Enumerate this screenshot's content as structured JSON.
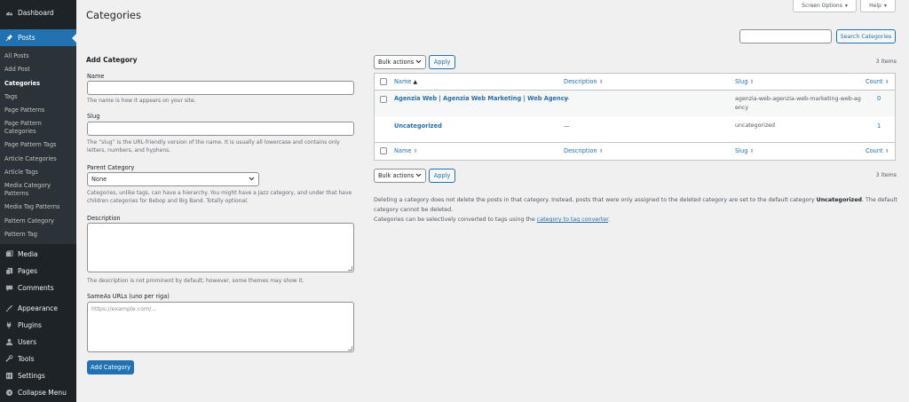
{
  "sidebar": {
    "dashboard": {
      "label": "Dashboard",
      "icon": "dashboard-icon"
    },
    "posts": {
      "label": "Posts",
      "icon": "pin-icon"
    },
    "submenu": [
      {
        "label": "All Posts"
      },
      {
        "label": "Add Post"
      },
      {
        "label": "Categories"
      },
      {
        "label": "Tags"
      },
      {
        "label": "Page Patterns"
      },
      {
        "label": "Page Pattern Categories"
      },
      {
        "label": "Page Pattern Tags"
      },
      {
        "label": "Article Categories"
      },
      {
        "label": "Article Tags"
      },
      {
        "label": "Media Category Patterns"
      },
      {
        "label": "Media Tag Patterns"
      },
      {
        "label": "Pattern Category"
      },
      {
        "label": "Pattern Tag"
      }
    ],
    "menu": [
      {
        "label": "Media",
        "icon": "media-icon"
      },
      {
        "label": "Pages",
        "icon": "pages-icon"
      },
      {
        "label": "Comments",
        "icon": "comments-icon"
      },
      {
        "label": "Appearance",
        "icon": "appearance-icon"
      },
      {
        "label": "Plugins",
        "icon": "plugins-icon"
      },
      {
        "label": "Users",
        "icon": "users-icon"
      },
      {
        "label": "Tools",
        "icon": "tools-icon"
      },
      {
        "label": "Settings",
        "icon": "settings-icon"
      },
      {
        "label": "Collapse Menu",
        "icon": "collapse-icon"
      }
    ]
  },
  "header": {
    "title": "Categories",
    "screen_options": "Screen Options",
    "help": "Help",
    "search_button": "Search Categories",
    "search_value": ""
  },
  "form": {
    "heading": "Add Category",
    "name_label": "Name",
    "name_value": "",
    "name_desc": "The name is how it appears on your site.",
    "slug_label": "Slug",
    "slug_value": "",
    "slug_desc": "The “slug” is the URL-friendly version of the name. It is usually all lowercase and contains only letters, numbers, and hyphens.",
    "parent_label": "Parent Category",
    "parent_value": "None",
    "parent_desc": "Categories, unlike tags, can have a hierarchy. You might have a Jazz category, and under that have children categories for Bebop and Big Band. Totally optional.",
    "description_label": "Description",
    "description_value": "",
    "description_desc": "The description is not prominent by default; however, some themes may show it.",
    "sameas_label": "SameAs URLs (uno per riga)",
    "sameas_placeholder": "https://example.com/...",
    "submit": "Add Category"
  },
  "list": {
    "bulk_label": "Bulk actions",
    "apply": "Apply",
    "items_count": "3 items",
    "columns": {
      "name": "Name",
      "description": "Description",
      "slug": "Slug",
      "count": "Count"
    },
    "rows": [
      {
        "name": "Agenzia Web | Agenzia Web Marketing | Web Agency",
        "description": "—",
        "slug": "agenzia-web-agenzia-web-marketing-web-agency",
        "count": "0"
      },
      {
        "name": "Uncategorized",
        "description": "—",
        "slug": "uncategorized",
        "count": "1"
      }
    ]
  },
  "notice": {
    "part1": "Deleting a category does not delete the posts in that category. Instead, posts that were only assigned to the deleted category are set to the default category ",
    "bold": "Uncategorized",
    "part2": ". The default category cannot be deleted.",
    "convert_prefix": "Categories can be selectively converted to tags using the ",
    "convert_link": "category to tag converter",
    "convert_suffix": "."
  },
  "colors": {
    "accent": "#2271b1",
    "sidebar_bg": "#1d2327",
    "sub_bg": "#2c3338",
    "page_bg": "#f0f0f1"
  }
}
